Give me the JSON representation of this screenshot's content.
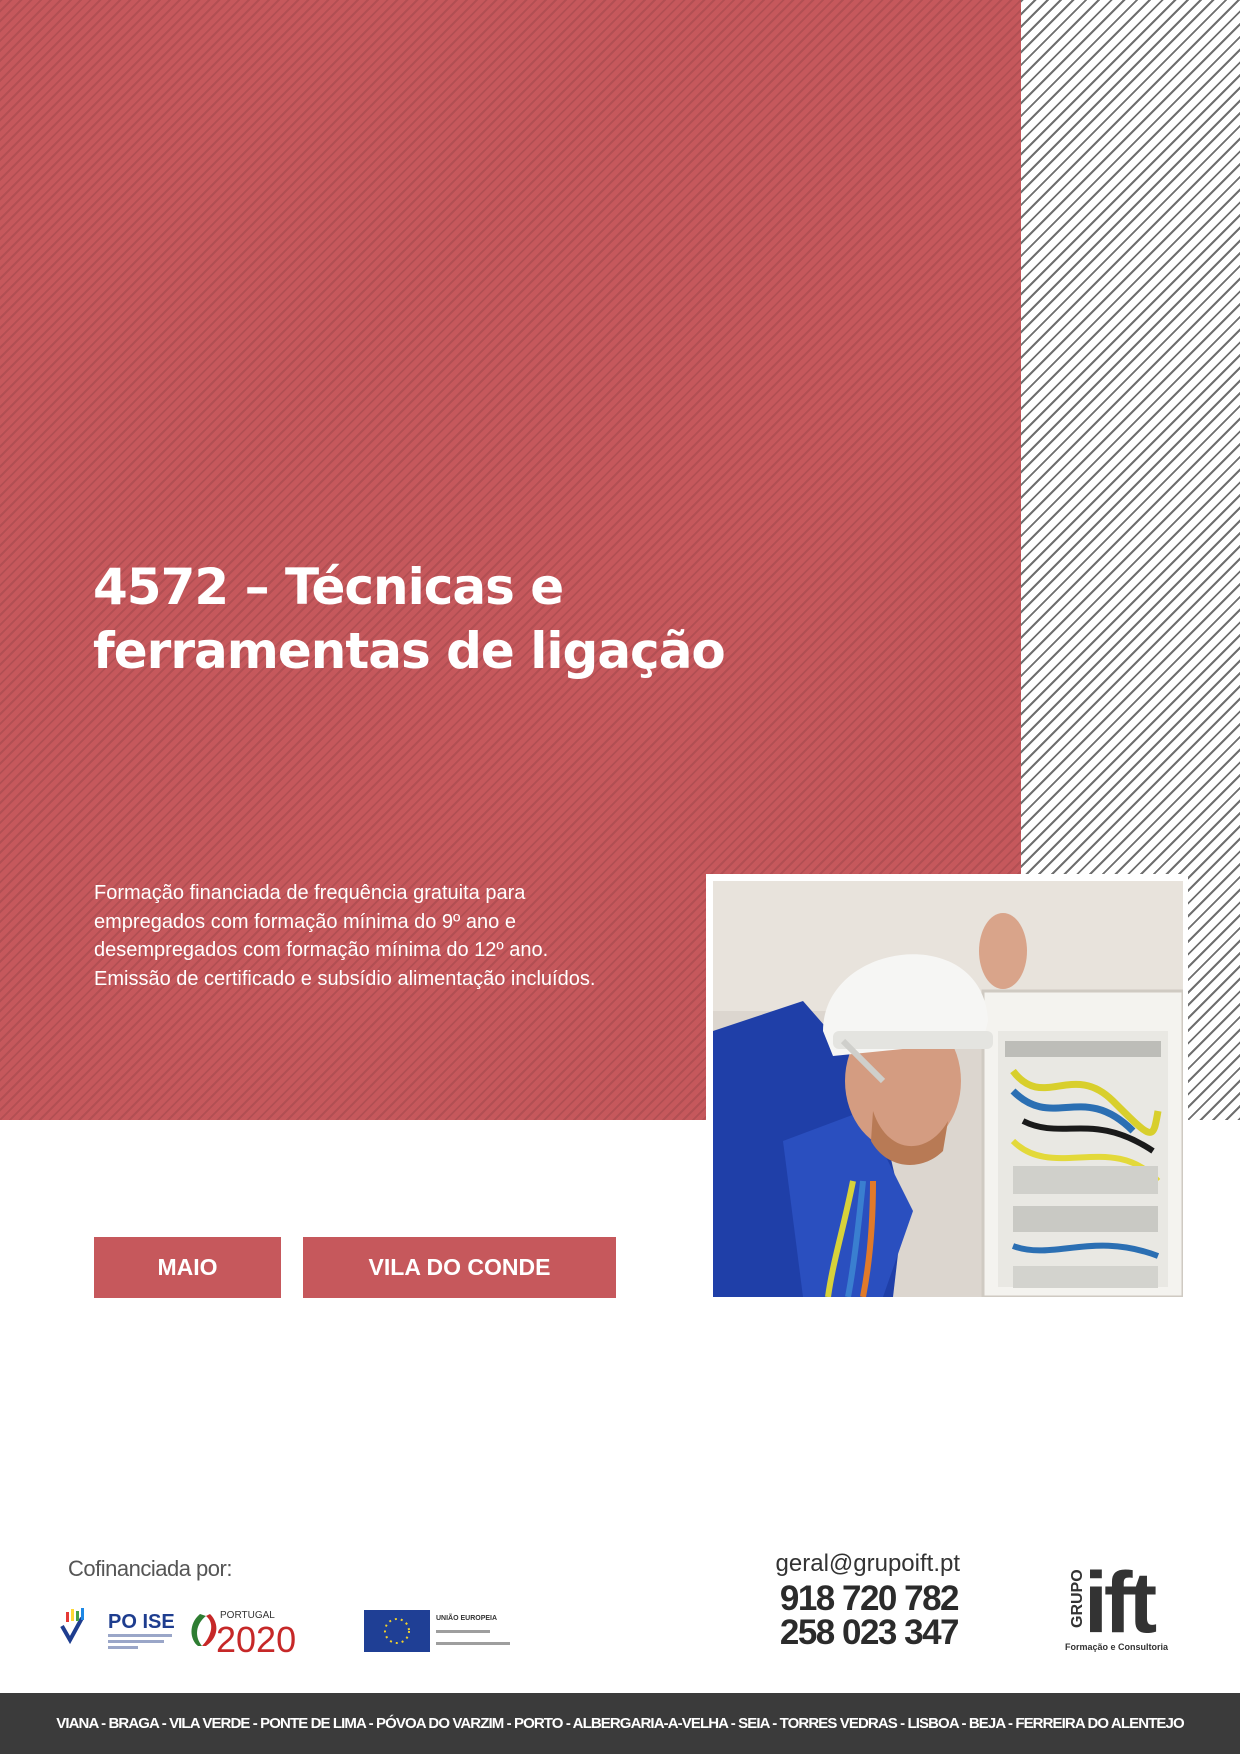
{
  "hero": {
    "title": "4572 – Técnicas e ferramentas de ligação",
    "description": "Formação financiada de frequência gratuita para empregados com formação mínima do 9º ano e desempregados com formação mínima do 12º ano. Emissão de certificado e subsídio alimentação incluídos."
  },
  "tags": {
    "month": "MAIO",
    "location": "VILA DO CONDE"
  },
  "funding": {
    "label": "Cofinanciada por:",
    "logos": {
      "poise": "PO ISE",
      "portugal": "PORTUGAL",
      "year": "2020",
      "eu": "UNIÃO EUROPEIA"
    }
  },
  "contact": {
    "email": "geral@grupoift.pt",
    "phone_1": "918 720 782",
    "phone_2": "258 023 347"
  },
  "brand": {
    "vertical": "GRUPO",
    "name": "ift",
    "subtitle": "Formação e Consultoria"
  },
  "footer": {
    "cities": "VIANA - BRAGA - VILA VERDE - PONTE DE LIMA - PÓVOA DO VARZIM - PORTO - ALBERGARIA-A-VELHA - SEIA - TORRES VEDRAS - LISBOA - BEJA - FERREIRA DO ALENTEJO"
  },
  "colors": {
    "accent_red": "#c6585c",
    "footer_dark": "#3b3b3b"
  },
  "icons": {
    "photo": "electrician-photo",
    "poise_logo": "poise-logo",
    "portugal2020_logo": "portugal-2020-logo",
    "eu_flag": "eu-flag-logo",
    "brand_logo": "grupo-ift-logo"
  }
}
